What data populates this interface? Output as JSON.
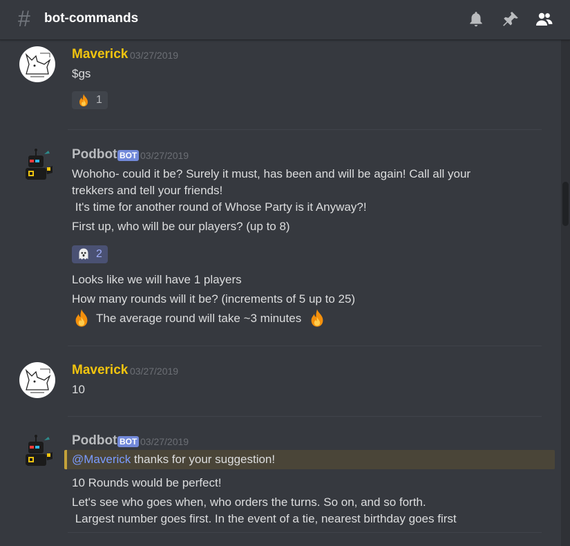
{
  "header": {
    "channel_name": "bot-commands",
    "icons": [
      "bell-icon",
      "pin-icon",
      "members-icon"
    ]
  },
  "messages": [
    {
      "author": "Maverick",
      "timestamp": "03/27/2019",
      "lines": [
        "$gs"
      ],
      "reaction": {
        "emoji": "fire",
        "count": "1"
      }
    },
    {
      "author": "Podbot",
      "bot_tag": "BOT",
      "timestamp": "03/27/2019",
      "lines": [
        "Wohoho- could it be? Surely it must, has been and will be again! Call all your",
        "trekkers and tell your friends!",
        " It's time for another round of Whose Party is it Anyway?!",
        "First up, who will be our players? (up to 8)"
      ],
      "reaction": {
        "emoji": "ghost",
        "count": "2"
      },
      "lines_after": [
        "Looks like we will have 1 players",
        "How many rounds will it be? (increments of 5 up to 25)",
        "The average round will take ~3 minutes"
      ]
    },
    {
      "author": "Maverick",
      "timestamp": "03/27/2019",
      "lines": [
        "10"
      ]
    },
    {
      "author": "Podbot",
      "bot_tag": "BOT",
      "timestamp": "03/27/2019",
      "quote": {
        "mention": "@Maverick",
        "text": " thanks for your suggestion!"
      },
      "lines": [
        "10 Rounds would be perfect!",
        "Let's see who goes when, who orders the turns. So on, and so forth.",
        " Largest number goes first. In the event of a tie, nearest birthday goes first"
      ]
    }
  ],
  "colors": {
    "background": "#36393f",
    "maverick_name": "#f1c40f",
    "bot_tag": "#7289da",
    "mention": "#7a9bff"
  }
}
